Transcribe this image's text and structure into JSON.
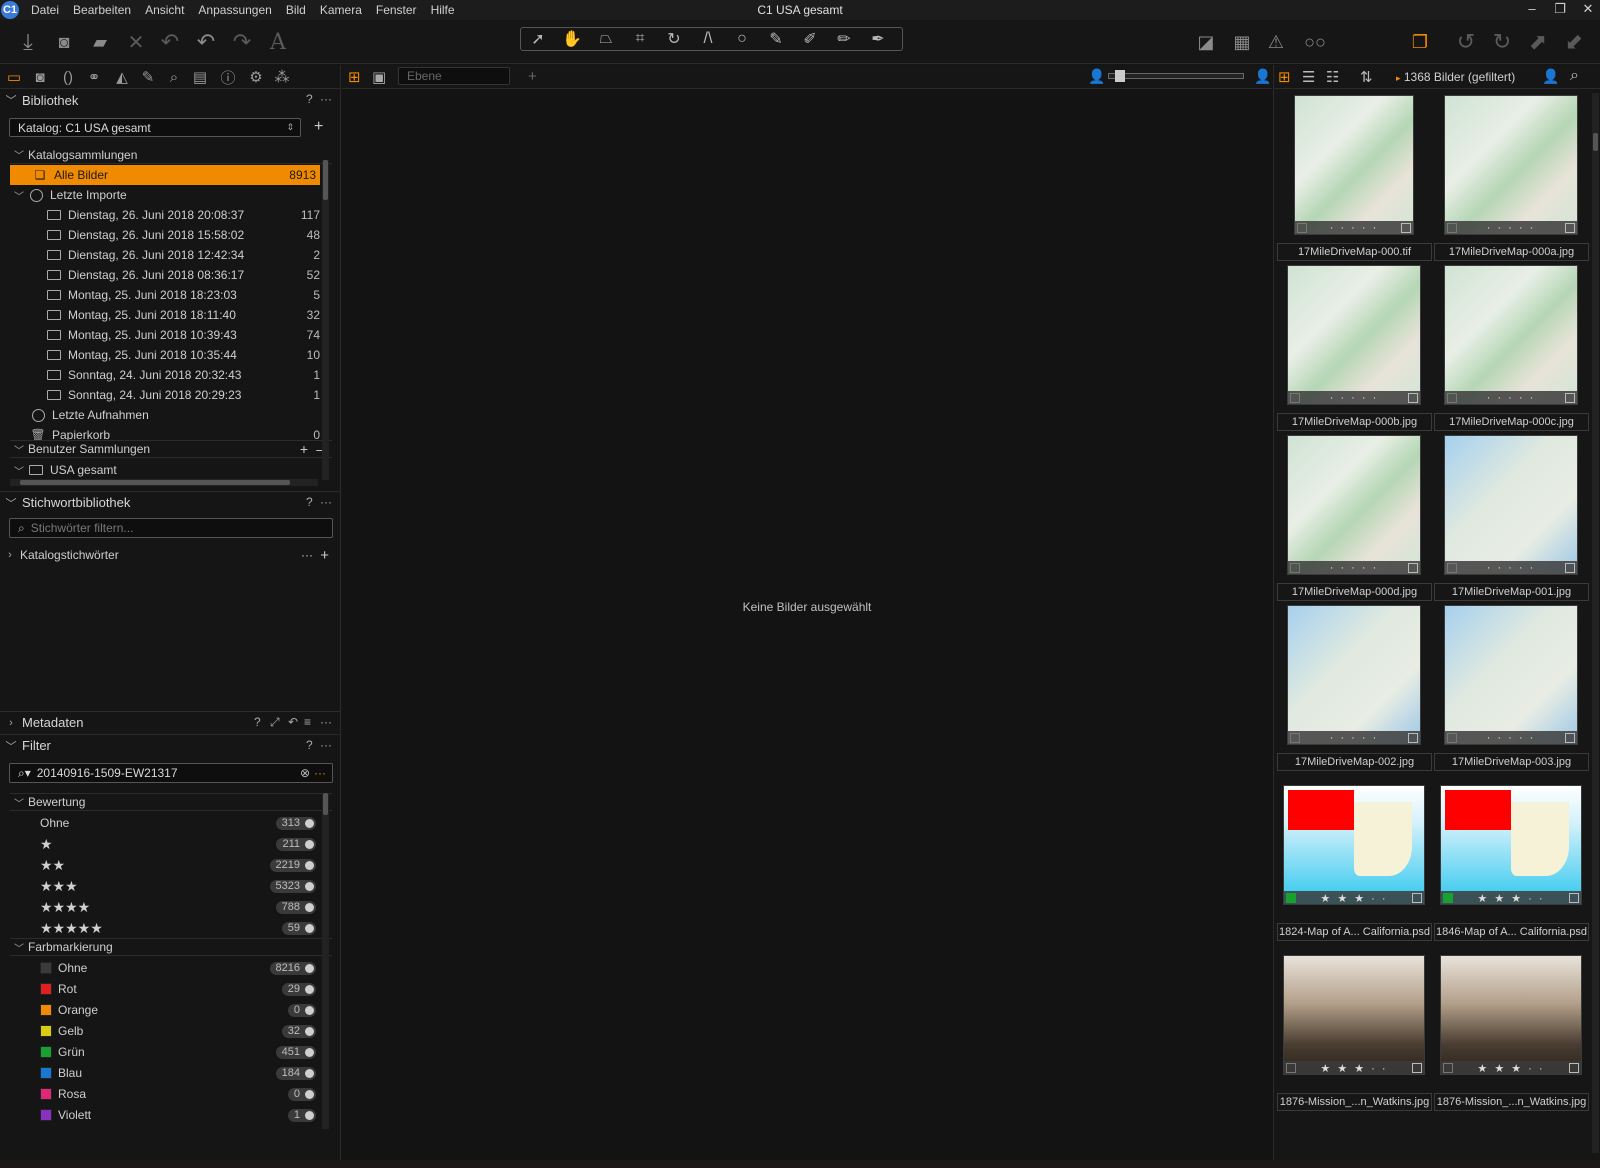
{
  "menubar": {
    "app_icon": "C1",
    "menus": [
      "Datei",
      "Bearbeiten",
      "Ansicht",
      "Anpassungen",
      "Bild",
      "Kamera",
      "Fenster",
      "Hilfe"
    ],
    "title": "C1 USA gesamt"
  },
  "toolbar": {
    "icons": [
      "import-icon",
      "camera-icon",
      "export-icon",
      "delete-icon",
      "undo-all-icon",
      "undo-icon",
      "redo-icon",
      "text-icon"
    ],
    "cursor_tools": [
      "select-cursor-icon",
      "pan-hand-icon",
      "keystone-icon",
      "crop-icon",
      "rotate-icon",
      "straighten-icon",
      "spot-icon",
      "brush-icon",
      "gradient-icon",
      "eraser-icon",
      "pick-icon"
    ],
    "right_icons": [
      "exposure-warning-icon",
      "grid-icon",
      "warning-icon",
      "proof-glasses-icon",
      "viewer-copies-icon",
      "reset-icon",
      "apply-icon",
      "copy-adjustments-icon",
      "paste-adjustments-icon"
    ]
  },
  "library": {
    "title": "Bibliothek",
    "help": "?",
    "more": "···",
    "catalog_label": "Katalog: C1 USA gesamt",
    "catalog_group": "Katalogsammlungen",
    "all_images": {
      "label": "Alle Bilder",
      "count": "8913"
    },
    "recent_imports": "Letzte Importe",
    "imports": [
      {
        "label": "Dienstag, 26. Juni 2018 20:08:37",
        "count": "117"
      },
      {
        "label": "Dienstag, 26. Juni 2018 15:58:02",
        "count": "48"
      },
      {
        "label": "Dienstag, 26. Juni 2018 12:42:34",
        "count": "2"
      },
      {
        "label": "Dienstag, 26. Juni 2018 08:36:17",
        "count": "52"
      },
      {
        "label": "Montag, 25. Juni 2018 18:23:03",
        "count": "5"
      },
      {
        "label": "Montag, 25. Juni 2018 18:11:40",
        "count": "32"
      },
      {
        "label": "Montag, 25. Juni 2018 10:39:43",
        "count": "74"
      },
      {
        "label": "Montag, 25. Juni 2018 10:35:44",
        "count": "10"
      },
      {
        "label": "Sonntag, 24. Juni 2018 20:32:43",
        "count": "1"
      },
      {
        "label": "Sonntag, 24. Juni 2018 20:29:23",
        "count": "1"
      }
    ],
    "recent_captures": "Letzte Aufnahmen",
    "trash": {
      "label": "Papierkorb",
      "count": "0"
    },
    "user_collections": "Benutzer Sammlungen",
    "usa_folder": "USA gesamt"
  },
  "keywords": {
    "title": "Stichwortbibliothek",
    "placeholder": "Stichwörter filtern...",
    "catalog_keywords": "Katalogstichwörter"
  },
  "metadata": {
    "title": "Metadaten"
  },
  "filter": {
    "title": "Filter",
    "search_value": "20140916-1509-EW21317",
    "rating_group": "Bewertung",
    "ratings": [
      {
        "label": "Ohne",
        "stars": "",
        "count": "313"
      },
      {
        "label": "",
        "stars": "★",
        "count": "211"
      },
      {
        "label": "",
        "stars": "★★",
        "count": "2219"
      },
      {
        "label": "",
        "stars": "★★★",
        "count": "5323"
      },
      {
        "label": "",
        "stars": "★★★★",
        "count": "788"
      },
      {
        "label": "",
        "stars": "★★★★★",
        "count": "59"
      }
    ],
    "color_group": "Farbmarkierung",
    "colors": [
      {
        "label": "Ohne",
        "color": "#3a3a3a",
        "count": "8216"
      },
      {
        "label": "Rot",
        "color": "#e02020",
        "count": "29"
      },
      {
        "label": "Orange",
        "color": "#f08a00",
        "count": "0"
      },
      {
        "label": "Gelb",
        "color": "#d8cc10",
        "count": "32"
      },
      {
        "label": "Grün",
        "color": "#18a030",
        "count": "451"
      },
      {
        "label": "Blau",
        "color": "#1878d0",
        "count": "184"
      },
      {
        "label": "Rosa",
        "color": "#e02878",
        "count": "0"
      },
      {
        "label": "Violett",
        "color": "#8a30c0",
        "count": "1"
      }
    ]
  },
  "viewer": {
    "layer_placeholder": "Ebene",
    "no_selection": "Keine Bilder ausgewählt"
  },
  "browser": {
    "count_label": "1368 Bilder (gefiltert)",
    "items": [
      {
        "name": "17MileDriveMap-000.tif",
        "kind": "map"
      },
      {
        "name": "17MileDriveMap-000a.jpg",
        "kind": "map"
      },
      {
        "name": "17MileDriveMap-000b.jpg",
        "kind": "map"
      },
      {
        "name": "17MileDriveMap-000c.jpg",
        "kind": "map"
      },
      {
        "name": "17MileDriveMap-000d.jpg",
        "kind": "map"
      },
      {
        "name": "17MileDriveMap-001.jpg",
        "kind": "route"
      },
      {
        "name": "17MileDriveMap-002.jpg",
        "kind": "route"
      },
      {
        "name": "17MileDriveMap-003.jpg",
        "kind": "route"
      },
      {
        "name": "1824-Map of A... California.psd",
        "kind": "mexico"
      },
      {
        "name": "1846-Map of A... California.psd",
        "kind": "mexico"
      },
      {
        "name": "1876-Mission_...n_Watkins.jpg",
        "kind": "sepia"
      },
      {
        "name": "1876-Mission_...n_Watkins.jpg",
        "kind": "sepia"
      }
    ]
  }
}
